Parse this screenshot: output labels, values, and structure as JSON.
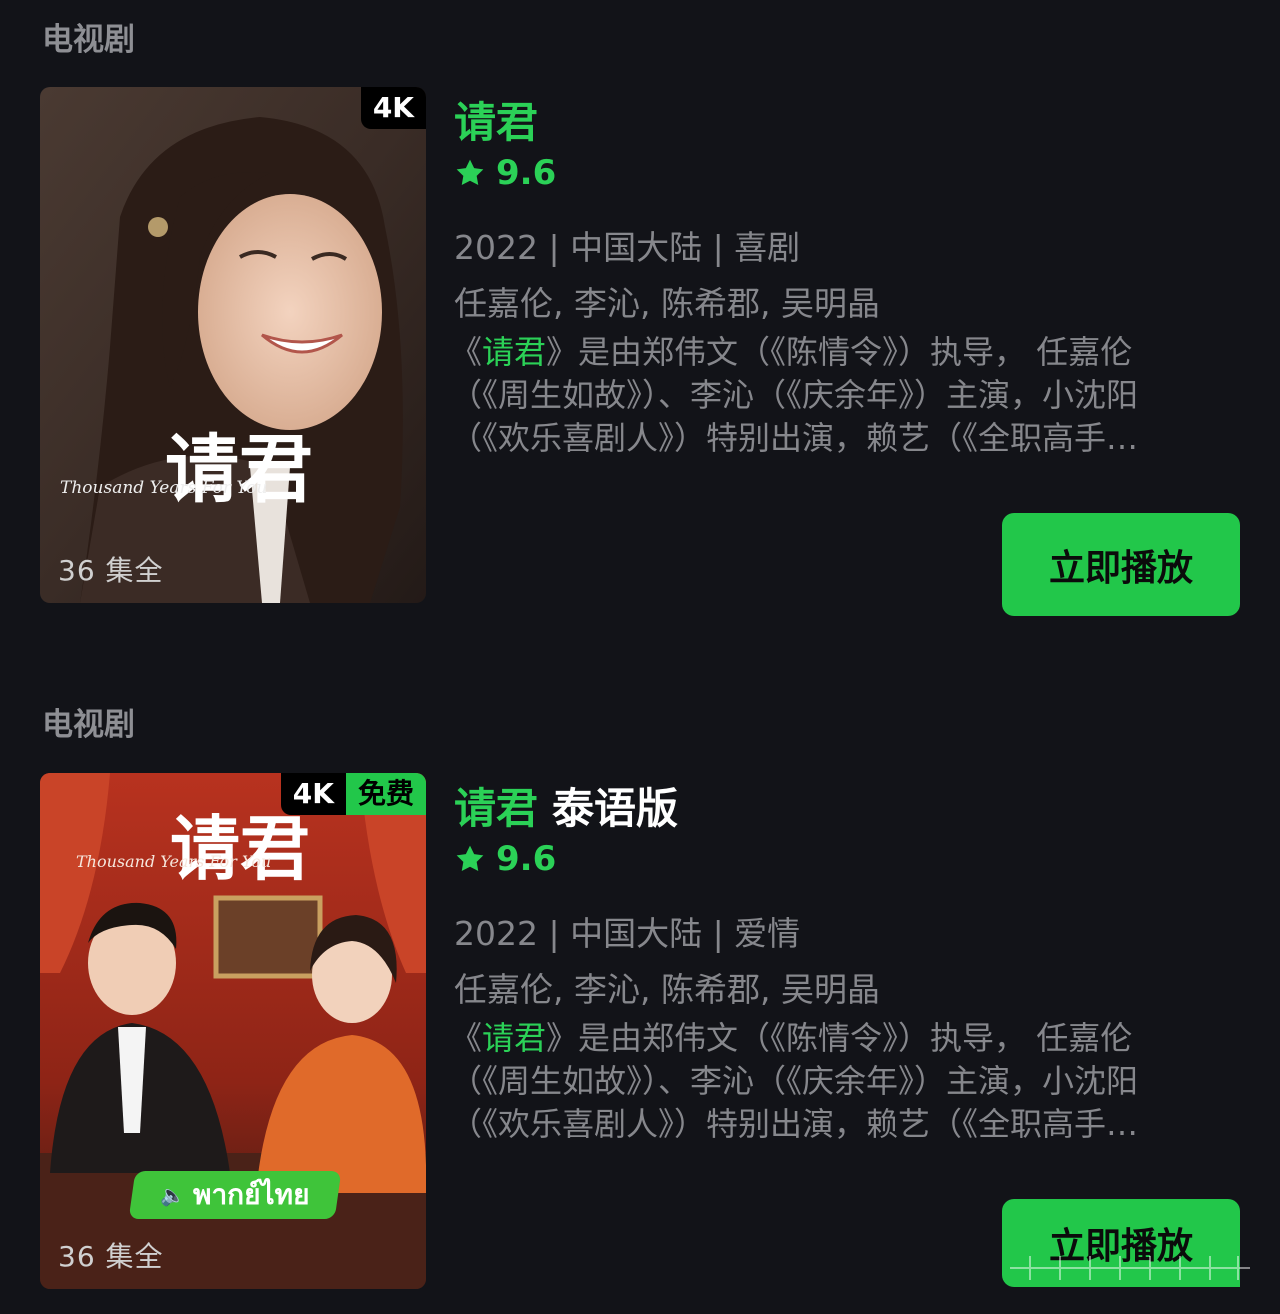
{
  "sections": [
    {
      "label": "电视剧",
      "card": {
        "badges": {
          "quality": "4K"
        },
        "poster_title": "请君",
        "poster_title_en": "Thousand Years For You",
        "episodes": "36 集全",
        "title": "请君",
        "subtitle": "",
        "rating": "9.6",
        "meta": "2022 | 中国大陆 | 喜剧",
        "cast": "任嘉伦, 李沁, 陈希郡, 吴明晶",
        "desc_prefix": "《",
        "desc_highlight": "请君",
        "desc_body": "》是由郑伟文（《陈情令》）执导，  任嘉伦（《周生如故》）、李沁（《庆余年》）主演，小沈阳（《欢乐喜剧人》）特别出演，赖艺（《全职高手…",
        "play_label": "立即播放"
      }
    },
    {
      "label": "电视剧",
      "card": {
        "badges": {
          "quality": "4K",
          "free": "免费"
        },
        "poster_title": "请君",
        "poster_title_en": "Thousand Years For You",
        "poster_thai": "พากย์ไทย",
        "episodes": "36 集全",
        "title": "请君",
        "subtitle": "泰语版",
        "rating": "9.6",
        "meta": "2022 | 中国大陆 | 爱情",
        "cast": "任嘉伦, 李沁, 陈希郡, 吴明晶",
        "desc_prefix": "《",
        "desc_highlight": "请君",
        "desc_body": "》是由郑伟文（《陈情令》）执导，  任嘉伦（《周生如故》）、李沁（《庆余年》）主演，小沈阳（《欢乐喜剧人》）特别出演，赖艺（《全职高手…",
        "play_label": "立即播放"
      }
    }
  ],
  "colors": {
    "background": "#121318",
    "accent": "#2bd157",
    "button": "#22c74a",
    "text_muted": "#86878c"
  },
  "icons": {
    "rating": "star-icon",
    "speaker": "speaker-icon"
  }
}
